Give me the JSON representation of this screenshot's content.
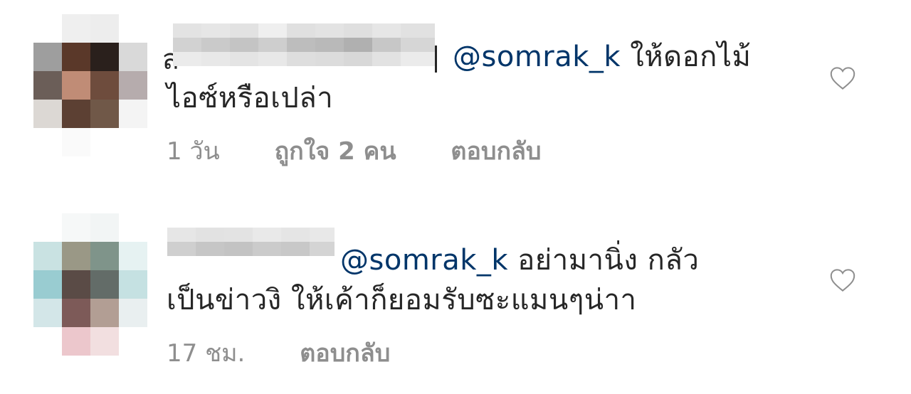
{
  "comments": [
    {
      "first_letter": "ส",
      "mention": "@somrak_k",
      "text_line1": " ให้ดอกไม้",
      "text_line2": "ไอซ์หรือเปล่า",
      "time": "1 วัน",
      "likes": "ถูกใจ 2 คน",
      "reply": "ตอบกลับ",
      "avatar_icon": "avatar-pixelated",
      "like_icon": "heart-outline-icon"
    },
    {
      "mention": "@somrak_k",
      "text_line1": " อย่ามานิ่ง กลัว",
      "text_line2": "เป็นข่าวงิ ให้เค้าก็ยอมรับซะแมนๆน่าา",
      "time": "17 ชม.",
      "reply": "ตอบกลับ",
      "avatar_icon": "avatar-pixelated",
      "like_icon": "heart-outline-icon"
    }
  ],
  "colors": {
    "text": "#262626",
    "mention": "#003569",
    "meta": "#8e8e8e",
    "heart": "#8e8e8e"
  }
}
